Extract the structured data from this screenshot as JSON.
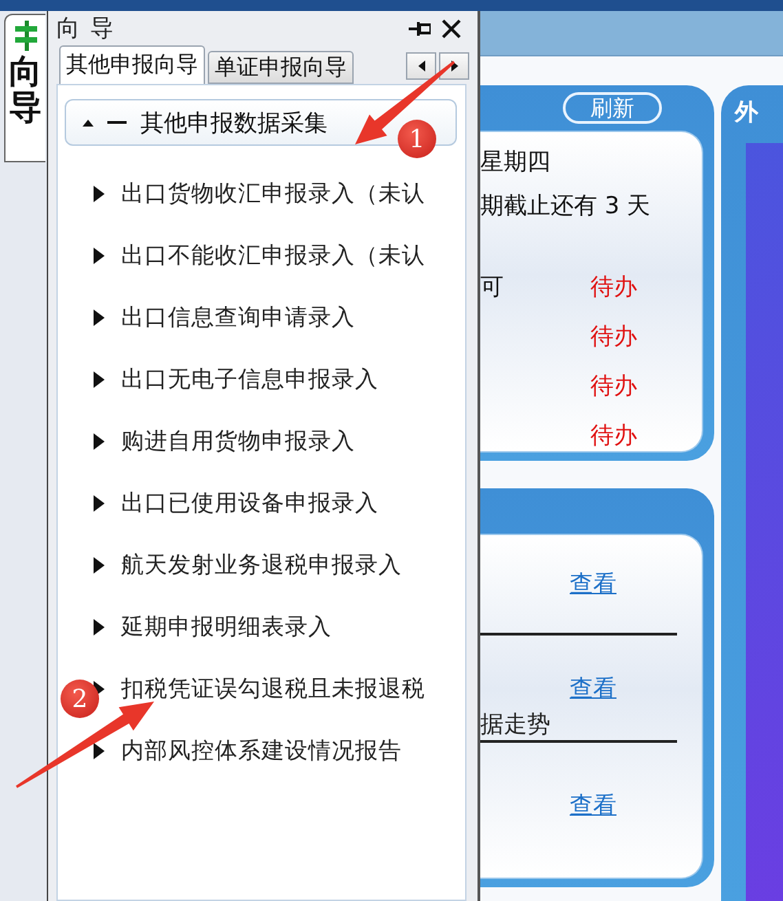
{
  "side_tab": {
    "label": "向导",
    "selected": true
  },
  "panel": {
    "title": "向 导"
  },
  "tabs": [
    {
      "label": "其他申报向导",
      "selected": true
    },
    {
      "label": "单证申报向导",
      "selected": false
    }
  ],
  "group": {
    "title": "其他申报数据采集",
    "expanded": true,
    "items": [
      {
        "label": "出口货物收汇申报录入（未认",
        "expanded": false
      },
      {
        "label": "出口不能收汇申报录入（未认",
        "expanded": false
      },
      {
        "label": "出口信息查询申请录入",
        "expanded": false
      },
      {
        "label": "出口无电子信息申报录入",
        "expanded": false
      },
      {
        "label": "购进自用货物申报录入",
        "expanded": false
      },
      {
        "label": "出口已使用设备申报录入",
        "expanded": false
      },
      {
        "label": "航天发射业务退税申报录入",
        "expanded": false
      },
      {
        "label": "延期申报明细表录入",
        "expanded": false
      },
      {
        "label": "扣税凭证误勾退税且未报退税",
        "expanded": false
      },
      {
        "label": "内部风控体系建设情况报告",
        "expanded": false
      }
    ]
  },
  "status_card": {
    "button": "刷新",
    "lines": [
      "星期四",
      "期截止还有 3 天"
    ],
    "tasks": [
      {
        "label": "可",
        "status": "待办"
      },
      {
        "status": "待办"
      },
      {
        "status": "待办"
      },
      {
        "status": "待办"
      }
    ]
  },
  "trend_card": {
    "rows": [
      {
        "link": "查看"
      },
      {
        "label": "据走势",
        "link": "查看"
      },
      {
        "link": "查看"
      }
    ]
  },
  "external_card": {
    "title": "外"
  },
  "annotations": [
    {
      "number": "1"
    },
    {
      "number": "2"
    }
  ]
}
